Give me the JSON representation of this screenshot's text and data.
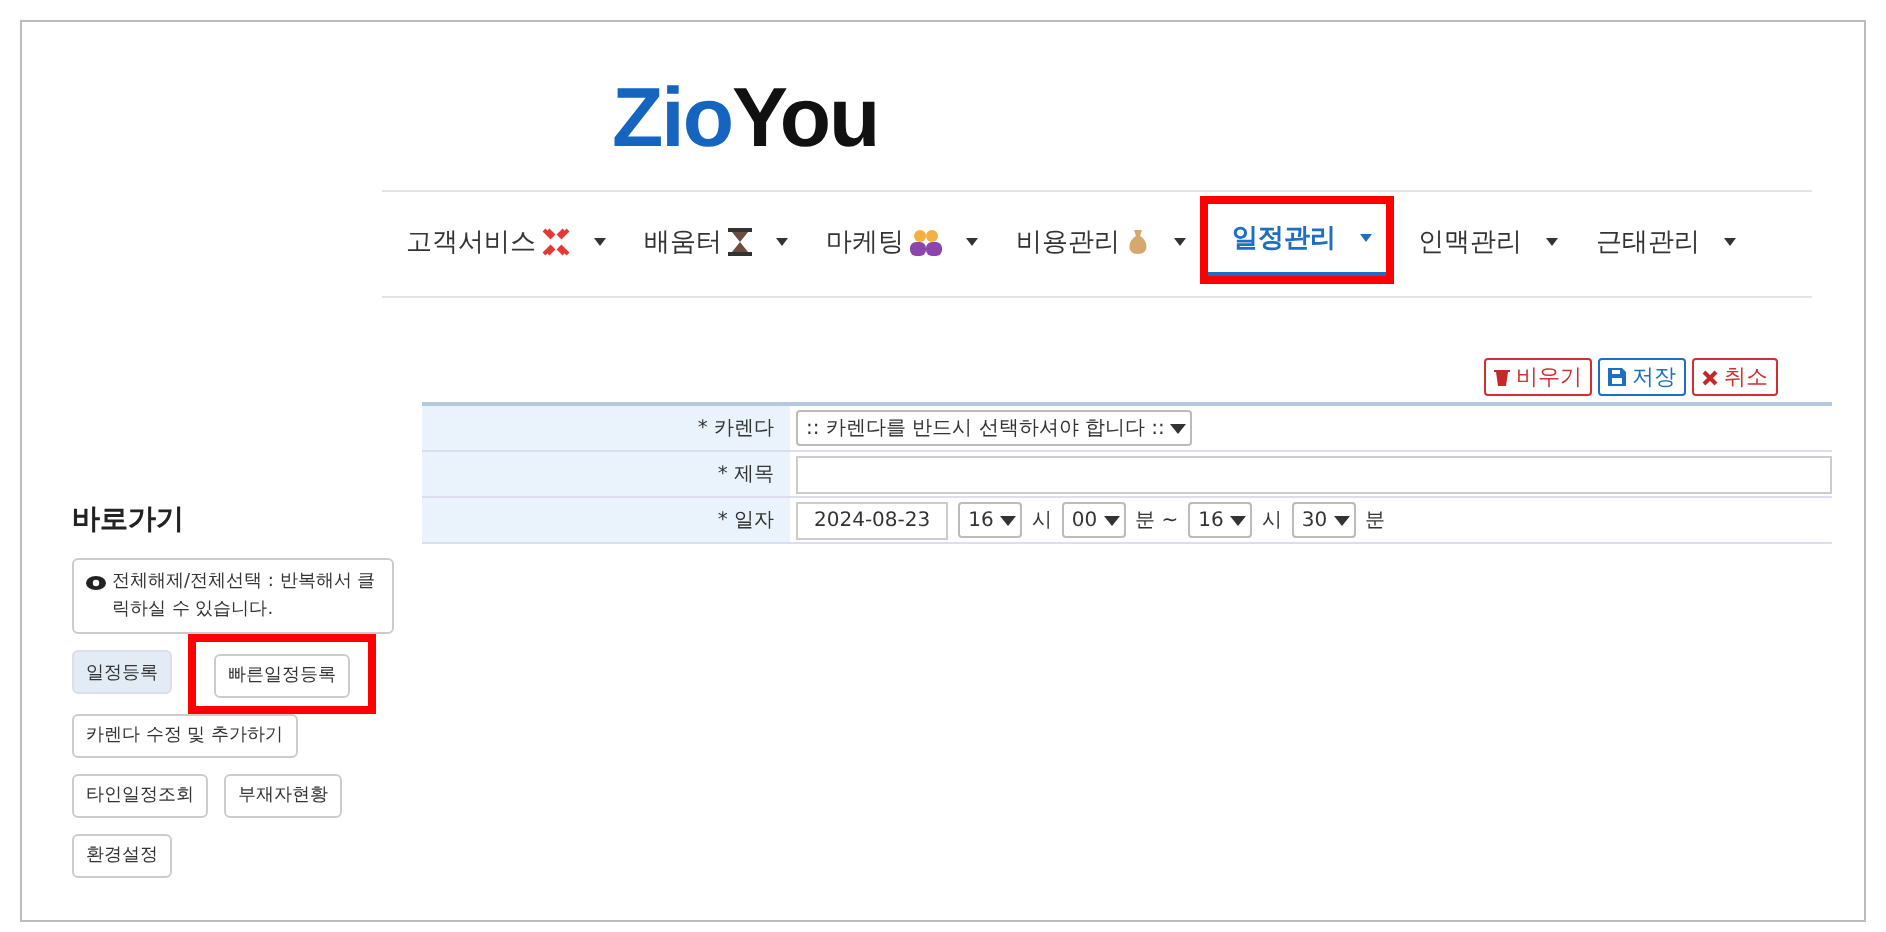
{
  "logo": {
    "part1": "Zio",
    "part2": "You"
  },
  "nav": [
    {
      "label": "고객서비스",
      "selected": false,
      "highlighted": false
    },
    {
      "label": "배움터",
      "selected": false,
      "highlighted": false
    },
    {
      "label": "마케팅",
      "selected": false,
      "highlighted": false
    },
    {
      "label": "비용관리",
      "selected": false,
      "highlighted": false
    },
    {
      "label": "일정관리",
      "selected": true,
      "highlighted": true
    },
    {
      "label": "인맥관리",
      "selected": false,
      "highlighted": false
    },
    {
      "label": "근태관리",
      "selected": false,
      "highlighted": false
    }
  ],
  "actions": [
    {
      "label": "비우기",
      "kind": "delete"
    },
    {
      "label": "저장",
      "kind": "save"
    },
    {
      "label": "취소",
      "kind": "cancel"
    }
  ],
  "form": {
    "calendar": {
      "label": "* 카렌다",
      "value": ":: 카렌다를 반드시 선택하셔야 합니다 ::"
    },
    "title": {
      "label": "* 제목"
    },
    "date": {
      "label": "* 일자",
      "value": "2024-08-23",
      "start_hour": "16",
      "hour_unit": "시",
      "start_minute": "00",
      "minute_unit": "분 ~",
      "end_hour": "16",
      "end_hour_unit": "시",
      "end_minute": "30",
      "end_minute_unit": "분"
    }
  },
  "sidebar": {
    "heading": "바로가기",
    "notice": "전체해제/전체선택 : 반복해서 클릭하실 수 있습니다.",
    "buttons": [
      [
        {
          "label": "일정등록",
          "selected": true,
          "highlighted": false
        },
        {
          "label": "빠른일정등록",
          "selected": false,
          "highlighted": true
        }
      ],
      [
        {
          "label": "카렌다 수정 및 추가하기",
          "selected": false,
          "highlighted": false
        }
      ],
      [
        {
          "label": "타인일정조회",
          "selected": false,
          "highlighted": false
        },
        {
          "label": "부재자현황",
          "selected": false,
          "highlighted": false
        }
      ],
      [
        {
          "label": "환경설정",
          "selected": false,
          "highlighted": false
        }
      ]
    ]
  }
}
